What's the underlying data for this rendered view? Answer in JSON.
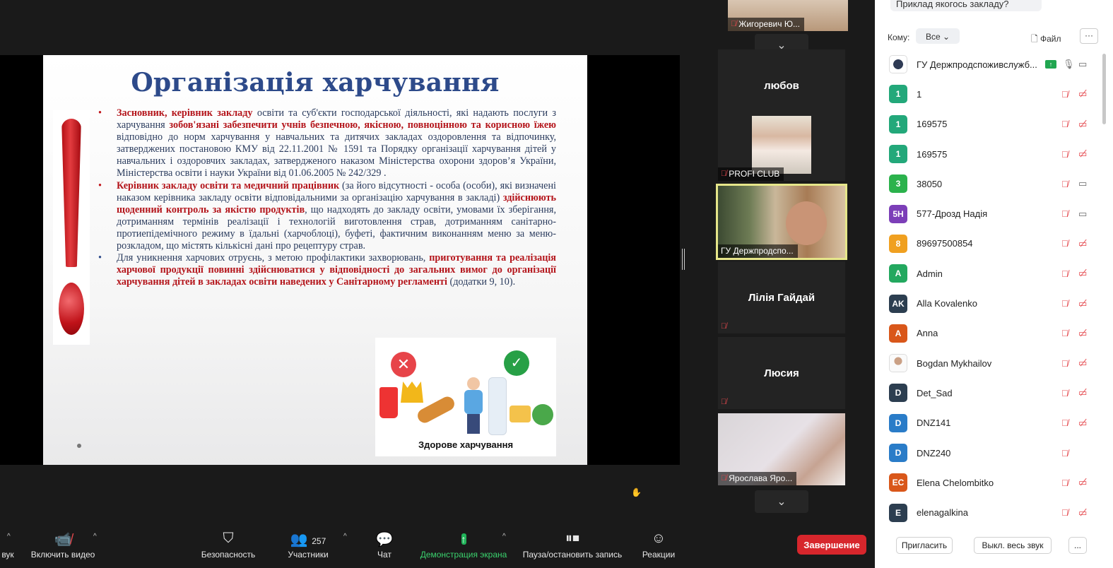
{
  "slide": {
    "title": "Організація харчування",
    "b1_pre_hl": "Засновник, керівник закладу",
    "b1_t1": " освіти та суб'єкти господарської діяльності, які надають послуги з харчування ",
    "b1_hl2": "зобов'язані забезпечити учнів безпечною, якісною, повноцінною та корисною їжею",
    "b1_t2": " відповідно до норм харчування у навчальних та дитячих закладах оздоровлення та відпочинку, затверджених постановою КМУ від 22.11.2001 № 1591 та Порядку організації харчування дітей у навчальних і оздоровчих закладах, затвердженого наказом Міністерства охорони здоров’я України, Міністерства освіти і науки України від 01.06.2005 № 242/329 .",
    "b2_hl1": "Керівник закладу освіти та медичний працівник",
    "b2_t1": " (за його відсутності - особа (особи), які визначені наказом керівника закладу освіти відповідальними за організацію харчування в закладі) ",
    "b2_hl2": "здійснюють щоденний контроль за якістю продуктів",
    "b2_t2": ", що надходять до закладу освіти, умовами їх зберігання, дотриманням термінів реалізації і технологій виготовлення страв, дотриманням санітарно-протиепідемічного режиму в їдальні (харчоблоці), буфеті, фактичним виконанням меню за меню-розкладом, що містять кількісні дані про рецептуру страв.",
    "b3_t1": "Для уникнення харчових отруєнь, з метою профілактики захворювань, ",
    "b3_hl1": "приготування та реалізація харчової продукції повинні здійснюватися у відповідності до загальних вимог до організації харчування дітей в закладах освіти наведених у Санітарному регламенті",
    "b3_t2": " (додатки 9, 10).",
    "infographic_caption": "Здорове харчування"
  },
  "video_tiles": [
    {
      "name": "Жигоревич Ю..."
    },
    {
      "name": "любов"
    },
    {
      "name": "PROFI CLUB"
    },
    {
      "name": "ГУ Держпродспо..."
    },
    {
      "name": "Лілія Гайдай"
    },
    {
      "name": "Люсия"
    },
    {
      "name": "Ярослава Яро..."
    }
  ],
  "chat": {
    "bubble": "Приклад якогось закладу?",
    "to_label": "Кому:",
    "to_value": "Все",
    "file_label": "Файл",
    "more": "···"
  },
  "participants": [
    {
      "avatar": "",
      "name": "ГУ Держпродспоживслужб...",
      "color": "#ffffff",
      "mic": "on",
      "cam": "on",
      "sharing": true
    },
    {
      "avatar": "1",
      "name": "1",
      "color": "#23a87a",
      "mic": "off",
      "cam": "off"
    },
    {
      "avatar": "1",
      "name": "169575",
      "color": "#23a87a",
      "mic": "off",
      "cam": "off"
    },
    {
      "avatar": "1",
      "name": "169575",
      "color": "#23a87a",
      "mic": "off",
      "cam": "off"
    },
    {
      "avatar": "3",
      "name": "38050",
      "color": "#2bb24c",
      "mic": "off",
      "cam": "on"
    },
    {
      "avatar": "5Н",
      "name": "577-Дрозд Надія",
      "color": "#7c3fb8",
      "mic": "off",
      "cam": "on"
    },
    {
      "avatar": "8",
      "name": "89697500854",
      "color": "#f0a020",
      "mic": "off",
      "cam": "off"
    },
    {
      "avatar": "A",
      "name": "Admin",
      "color": "#23a85f",
      "mic": "off",
      "cam": "off"
    },
    {
      "avatar": "AK",
      "name": "Alla Kovalenko",
      "color": "#2c3e50",
      "mic": "off",
      "cam": "off"
    },
    {
      "avatar": "A",
      "name": "Anna",
      "color": "#d9571a",
      "mic": "off",
      "cam": "off"
    },
    {
      "avatar": "",
      "name": "Bogdan Mykhailov",
      "color": "#f2f2f2",
      "mic": "off",
      "cam": "off"
    },
    {
      "avatar": "D",
      "name": "Det_Sad",
      "color": "#2c3e50",
      "mic": "off",
      "cam": "off"
    },
    {
      "avatar": "D",
      "name": "DNZ141",
      "color": "#2a7cc8",
      "mic": "off",
      "cam": "off"
    },
    {
      "avatar": "D",
      "name": "DNZ240",
      "color": "#2a7cc8",
      "mic": "off",
      "cam": "none"
    },
    {
      "avatar": "EC",
      "name": "Elena Chelombitko",
      "color": "#d9571a",
      "mic": "off",
      "cam": "off"
    },
    {
      "avatar": "E",
      "name": "elenagalkina",
      "color": "#2c3e50",
      "mic": "off",
      "cam": "off"
    }
  ],
  "panel_footer": {
    "invite": "Пригласить",
    "mute_all": "Выкл. весь звук",
    "more": "..."
  },
  "toolbar": {
    "audio_label": "вук",
    "video_label": "Включить видео",
    "security_label": "Безопасность",
    "participants_label": "Участники",
    "participants_count": "257",
    "chat_label": "Чат",
    "share_label": "Демонстрация экрана",
    "record_label": "Пауза/остановить запись",
    "reactions_label": "Реакции",
    "end_label": "Завершение"
  },
  "colors": {
    "share_green": "#21b45a",
    "end_red": "#d7262c",
    "muted_red": "#e5484d"
  }
}
